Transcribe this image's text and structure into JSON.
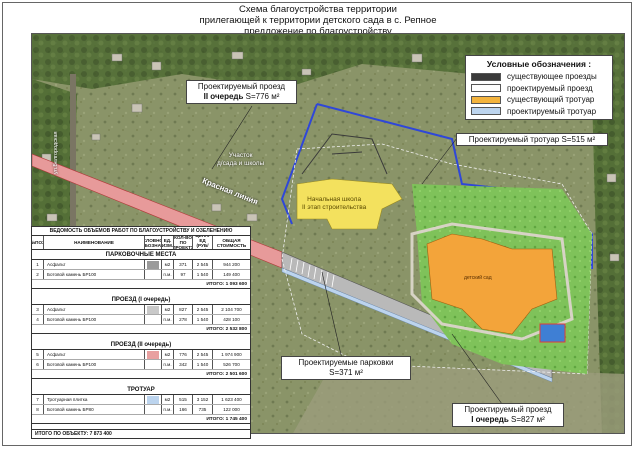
{
  "title": {
    "line1": "Схема благоустройства территории",
    "line2": "прилегающей к территории детского сада в с. Репное",
    "line3": "предложение по благоустройству"
  },
  "legend": {
    "title": "Условные обозначения :",
    "items": [
      {
        "label": "существующее проезды",
        "color": "#3a3a3a"
      },
      {
        "label": "проектируемый проезд",
        "color": "#ffffff"
      },
      {
        "label": "существующий тротуар",
        "color": "#f3b33d"
      },
      {
        "label": "проектируемый тротуар",
        "color": "#bcd4ee"
      }
    ]
  },
  "callouts": {
    "road2_line1": "Проектируемый проезд",
    "road2_line2_bold": "II очередь",
    "road2_line2_rest": " S=776 м²",
    "sidewalk": "Проектируемый тротуар S=515 м²",
    "parking_line1": "Проектируемые парковки",
    "parking_line2": "S=371 м²",
    "road1_line1": "Проектируемый проезд",
    "road1_line2_bold": "I очередь",
    "road1_line2_rest": " S=827 м²"
  },
  "map_labels": {
    "site": "Участок",
    "site2": "д/сада и школы",
    "red_line": "Красная линия",
    "school": "Начальная школа",
    "school2": "II этап строительства",
    "kindergarten": "детский сад",
    "street": "ул.Белгородская"
  },
  "table": {
    "title": "ВЕДОМОСТЬ ОБЪЕМОВ РАБОТ ПО БЛАГОУСТРОЙСТВУ И ОЗЕЛЕНЕНИЮ",
    "headers": [
      "№ПОЗ",
      "НАИМЕНОВАНИЕ",
      "УСЛОВНОЕ ОБОЗНАЧ.",
      "ЕД. ИЗМ.",
      "КОЛ-ВО ПО ПРОЕКТУ",
      "ЦЕНА/ЕД (РУБ/ЕД)",
      "ОБЩАЯ СТОИМОСТЬ"
    ],
    "sections": [
      {
        "name": "ПАРКОВОЧНЫЕ МЕСТА",
        "swatch": "#9a9a9a",
        "rows": [
          {
            "n": "1",
            "name": "Асфальт",
            "unit": "м2",
            "qty": "371",
            "price": "2 545",
            "total": "944 200"
          },
          {
            "n": "2",
            "name": "Ботовой камень БР100",
            "unit": "п.м.",
            "qty": "97",
            "price": "1 540",
            "total": "149 400"
          }
        ],
        "total": "ИТОГО: 1 093 600"
      },
      {
        "name": "ПРОЕЗД (I очередь)",
        "swatch": "#c9c9c9",
        "rows": [
          {
            "n": "3",
            "name": "Асфальт",
            "unit": "м2",
            "qty": "827",
            "price": "2 545",
            "total": "2 104 700"
          },
          {
            "n": "4",
            "name": "Ботовой камень БР100",
            "unit": "п.м.",
            "qty": "278",
            "price": "1 540",
            "total": "428 100"
          }
        ],
        "total": "ИТОГО: 2 532 800"
      },
      {
        "name": "ПРОЕЗД (II очередь)",
        "swatch": "#e8a0a0",
        "rows": [
          {
            "n": "5",
            "name": "Асфальт",
            "unit": "м2",
            "qty": "776",
            "price": "2 545",
            "total": "1 974 900"
          },
          {
            "n": "6",
            "name": "Ботовой камень БР100",
            "unit": "п.м.",
            "qty": "342",
            "price": "1 540",
            "total": "526 700"
          }
        ],
        "total": "ИТОГО: 2 501 600"
      },
      {
        "name": "ТРОТУАР",
        "swatch": "#bcd4ee",
        "rows": [
          {
            "n": "7",
            "name": "Тротуарная плитка",
            "unit": "м2",
            "qty": "515",
            "price": "3 152",
            "total": "1 623 400"
          },
          {
            "n": "8",
            "name": "Ботовой камень БР80",
            "unit": "п.м.",
            "qty": "166",
            "price": "735",
            "total": "122 000"
          }
        ],
        "total": "ИТОГО: 1 745 400"
      }
    ],
    "grand_total": "ИТОГО ПО ОБЪЕКТУ: 7 873 400"
  }
}
